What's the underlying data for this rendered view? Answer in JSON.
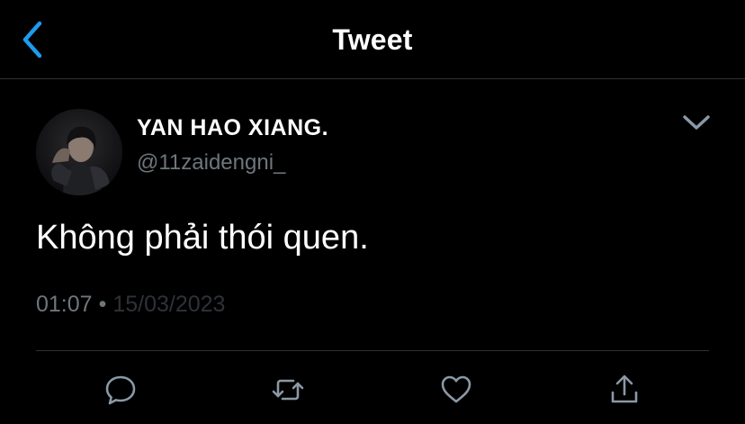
{
  "header": {
    "back_icon": "chevron-left-icon",
    "title": "Tweet"
  },
  "tweet": {
    "author": {
      "display_name": "YAN HAO XIANG.",
      "handle": "@11zaidengni_",
      "avatar_icon": "profile-photo"
    },
    "more_icon": "chevron-down-icon",
    "text": "Không phải thói quen.",
    "time": "01:07",
    "separator": "•",
    "date": "15/03/2023"
  },
  "actions": [
    {
      "icon": "reply-icon"
    },
    {
      "icon": "retweet-icon"
    },
    {
      "icon": "like-icon"
    },
    {
      "icon": "share-icon"
    }
  ],
  "colors": {
    "background": "#000000",
    "accent": "#1d9bf0",
    "text_primary": "#ffffff",
    "text_secondary": "#6e767d",
    "divider": "#2f3336"
  }
}
